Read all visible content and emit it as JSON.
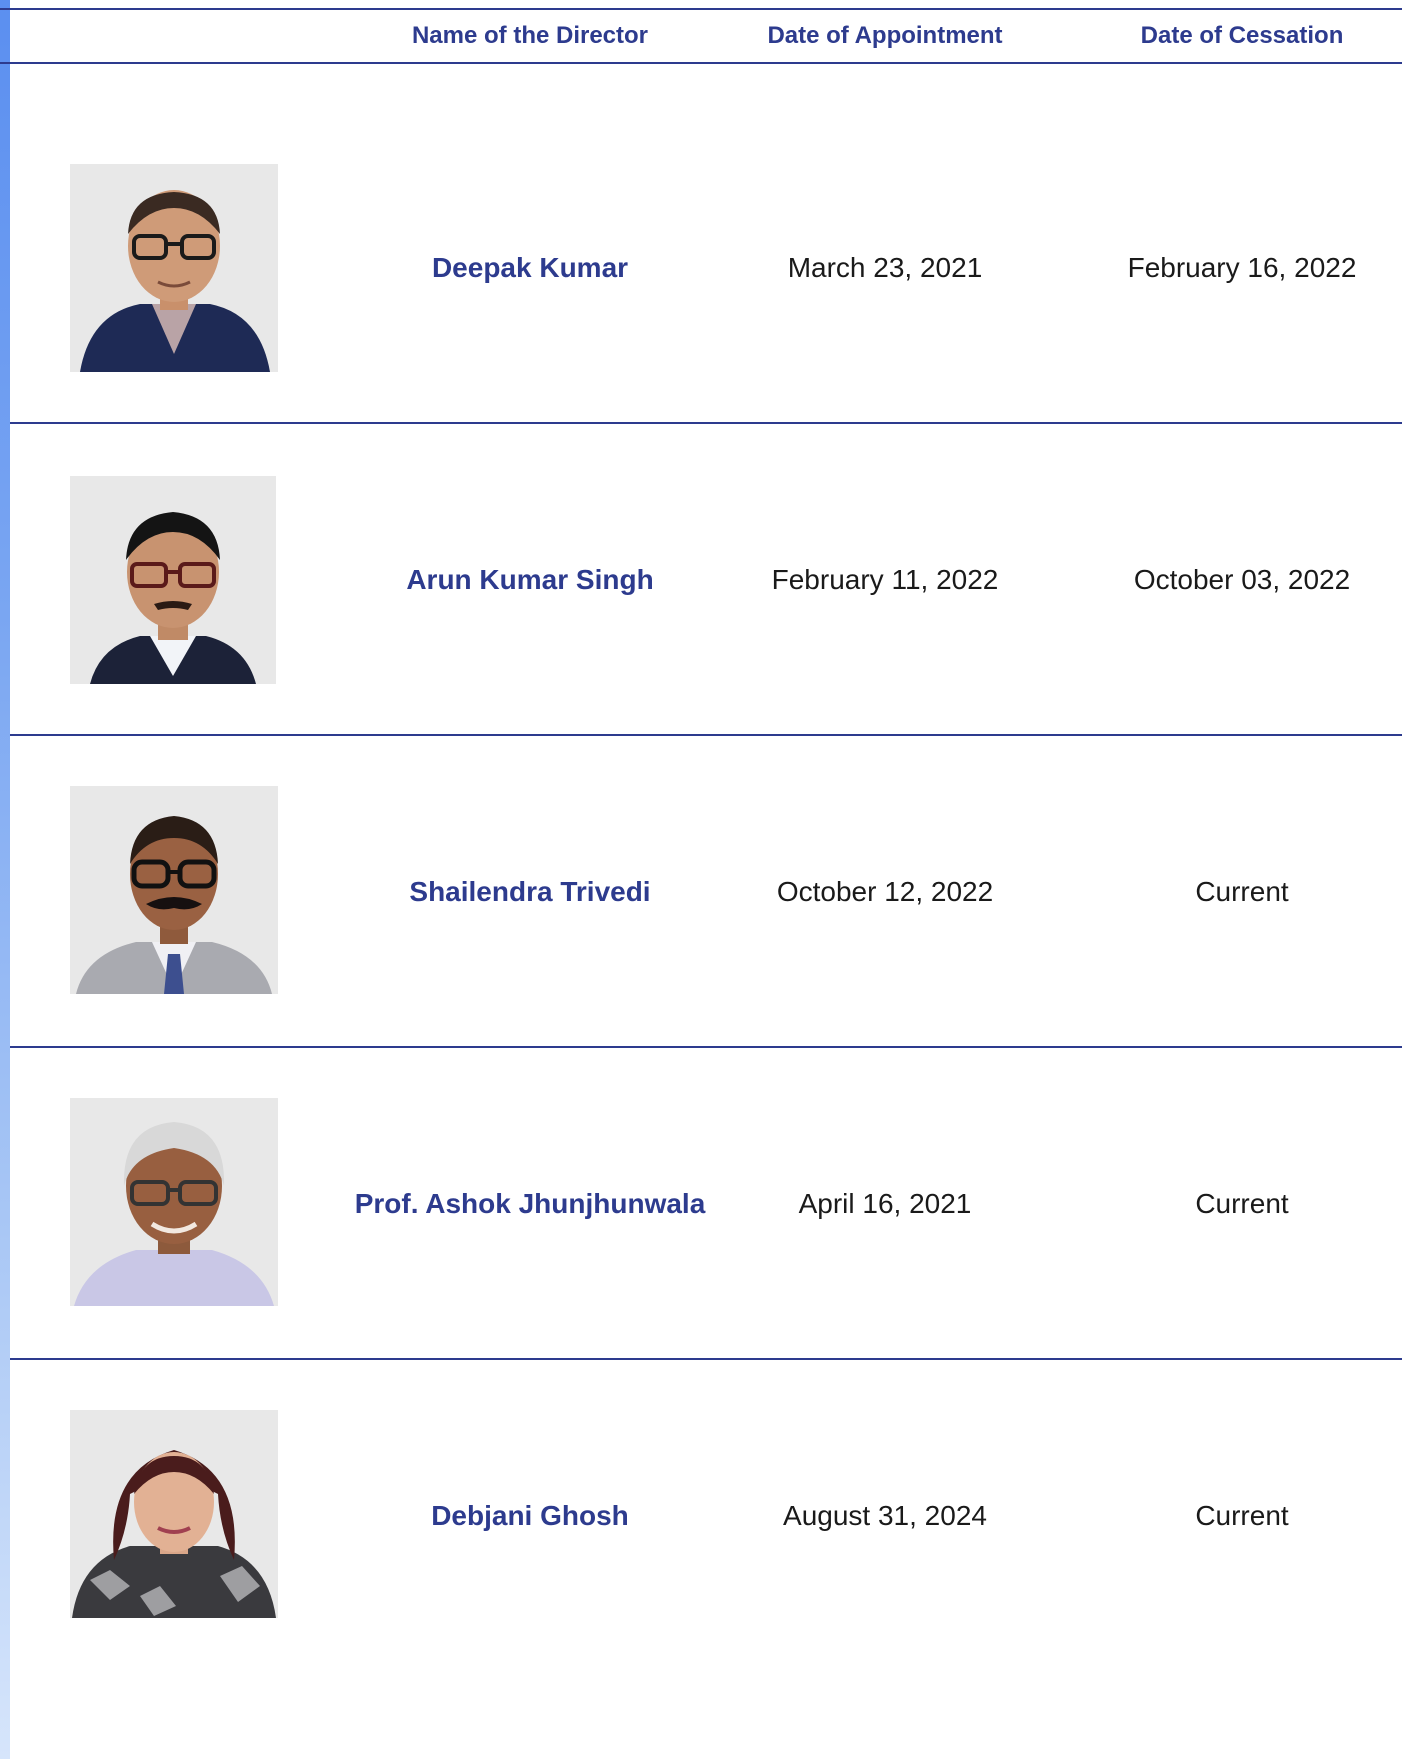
{
  "header": {
    "col_photo": "",
    "col_name": "Name of the Director",
    "col_appointment": "Date of Appointment",
    "col_cessation": "Date of Cessation"
  },
  "directors": [
    {
      "name": "Deepak Kumar",
      "appointment": "March 23, 2021",
      "cessation": "February 16, 2022"
    },
    {
      "name": "Arun Kumar Singh",
      "appointment": "February 11, 2022",
      "cessation": "October 03, 2022"
    },
    {
      "name": "Shailendra Trivedi",
      "appointment": "October 12, 2022",
      "cessation": "Current"
    },
    {
      "name": "Prof. Ashok Jhunjhunwala",
      "appointment": "April 16, 2021",
      "cessation": "Current"
    },
    {
      "name": "Debjani Ghosh",
      "appointment": "August 31, 2024",
      "cessation": "Current"
    }
  ],
  "colors": {
    "accent": "#2d3b8e",
    "text": "#1a1a1a",
    "photo_background": "#e8e8e8"
  }
}
